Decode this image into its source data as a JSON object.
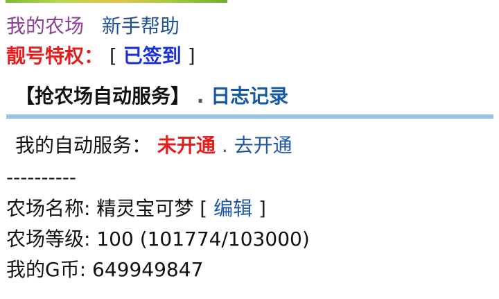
{
  "header": {
    "my_farm": "我的农场",
    "newbie_help": "新手帮助"
  },
  "privilege": {
    "label": "靓号特权：",
    "open_bracket": "[",
    "signed_in": "已签到",
    "close_bracket": "]"
  },
  "service_bar": {
    "grab_auto": "【抢农场自动服务】",
    "dot": ".",
    "log": "日志记录"
  },
  "auto_service": {
    "label": "我的自动服务：",
    "status": "未开通",
    "dot": ".",
    "activate": "去开通"
  },
  "divider_text": "----------",
  "farm_name": {
    "label": "农场名称:",
    "value": "精灵宝可梦",
    "open_bracket": "[",
    "edit": "编辑",
    "close_bracket": "]"
  },
  "farm_level": {
    "label": "农场等级:",
    "value": "100 (101774/103000)"
  },
  "coins": {
    "label": "我的G币:",
    "value": "649949847"
  },
  "colors": {
    "purple": "#8d3f96",
    "red": "#e51d1d",
    "blue": "#1a2ed8",
    "link": "#1d56a8",
    "divider": "#98bfe9"
  }
}
